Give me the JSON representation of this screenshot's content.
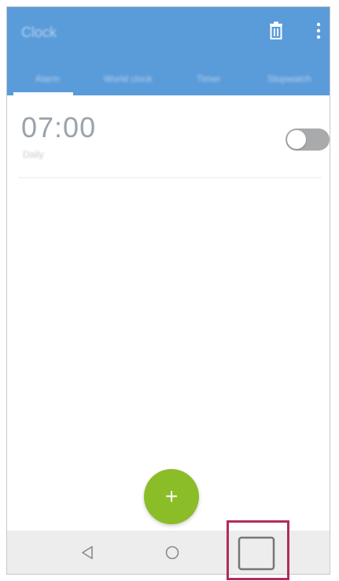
{
  "appbar": {
    "title": "Clock",
    "icons": {
      "delete": "delete-icon",
      "more": "more-vert-icon"
    }
  },
  "tabs": [
    {
      "label": "Alarm",
      "selected": true
    },
    {
      "label": "World clock",
      "selected": false
    },
    {
      "label": "Timer",
      "selected": false
    },
    {
      "label": "Stopwatch",
      "selected": false
    }
  ],
  "alarms": [
    {
      "time": "07:00",
      "subtitle": "Daily",
      "enabled": false
    }
  ],
  "fab": {
    "label": "+",
    "icon": "add-icon"
  },
  "navbar": {
    "icons": [
      "back-icon",
      "home-icon",
      "recent-apps-icon"
    ]
  },
  "colors": {
    "appbar": "#5a9bd9",
    "fab": "#8bbd29",
    "highlight": "#b22b5e",
    "navbar": "#ededed"
  }
}
